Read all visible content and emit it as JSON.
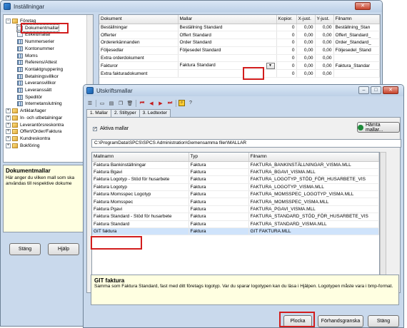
{
  "back_window": {
    "title": "Inställningar",
    "tree": [
      {
        "label": "Företag",
        "exp": "−",
        "icon": "folder",
        "indent": 0
      },
      {
        "label": "Dokumentmallar",
        "icon": "doc",
        "indent": 1,
        "selected": true
      },
      {
        "label": "Etikettmallar",
        "icon": "doc",
        "indent": 1
      },
      {
        "label": "Nummerserier",
        "icon": "grid",
        "indent": 1
      },
      {
        "label": "Kontonummer",
        "icon": "grid",
        "indent": 1
      },
      {
        "label": "Moms",
        "icon": "grid",
        "indent": 1
      },
      {
        "label": "Referens/Attest",
        "icon": "grid",
        "indent": 1
      },
      {
        "label": "Kontaktgruppering",
        "icon": "grid",
        "indent": 1
      },
      {
        "label": "Betalningsvillkor",
        "icon": "grid",
        "indent": 1
      },
      {
        "label": "Leveransvillkor",
        "icon": "grid",
        "indent": 1
      },
      {
        "label": "Leveranssätt",
        "icon": "grid",
        "indent": 1
      },
      {
        "label": "Speditör",
        "icon": "grid",
        "indent": 1
      },
      {
        "label": "Internetanslutning",
        "icon": "grid",
        "indent": 1
      },
      {
        "label": "Artiklar/lager",
        "exp": "+",
        "icon": "folder",
        "indent": 0
      },
      {
        "label": "In- och utbetalningar",
        "exp": "+",
        "icon": "folder",
        "indent": 0
      },
      {
        "label": "Leverantörsreskontra",
        "exp": "+",
        "icon": "folder",
        "indent": 0
      },
      {
        "label": "Offert/Order/Faktura",
        "exp": "+",
        "icon": "folder",
        "indent": 0
      },
      {
        "label": "Kundreskontra",
        "exp": "+",
        "icon": "folder",
        "indent": 0
      },
      {
        "label": "Bokföring",
        "exp": "+",
        "icon": "folder",
        "indent": 0
      }
    ],
    "desc": {
      "heading": "Dokumentmallar",
      "text1": "Här anger du vilken mall som ska",
      "text2": "användas till respektive dokume"
    },
    "buttons": {
      "close": "Stäng",
      "help": "Hjälp"
    },
    "grid": {
      "columns": [
        "Dokument",
        "Mallar",
        "Kopior.",
        "X-just.",
        "Y-just.",
        "Filnamn"
      ],
      "rows": [
        [
          "Beställningar",
          "Beställning Standard",
          "0",
          "0,00",
          "0,00",
          "Beställning_Stan"
        ],
        [
          "Offerter",
          "Offert Standard",
          "0",
          "0,00",
          "0,00",
          "Offert_Standard_"
        ],
        [
          "Ordererkännanden",
          "Order Standard",
          "0",
          "0,00",
          "0,00",
          "Order_Standard_"
        ],
        [
          "Följesedlar",
          "Följesedel Standard",
          "0",
          "0,00",
          "0,00",
          "Följesedel_Stand"
        ],
        [
          "Extra orderdokument",
          "",
          "0",
          "0,00",
          "0,00",
          ""
        ],
        [
          "Fakturor",
          "Faktura Standard",
          "0",
          "0,00",
          "0,00",
          "Faktura_Standar"
        ],
        [
          "Extra fakturadokument",
          "",
          "0",
          "0,00",
          "0,00",
          ""
        ]
      ]
    }
  },
  "front_window": {
    "title": "Utskriftsmallar",
    "tabs": [
      "1. Mallar",
      "2. Stiltyper",
      "3. Ledtexter"
    ],
    "active_mallar_label": "Aktiva mallar",
    "fetch_button": "Hämta mallar...",
    "path": "C:\\ProgramData\\SPCS\\SPCS Administration\\Gemensamma filer\\MALLAR",
    "columns": [
      "Mallnamn",
      "Typ",
      "Filnamn"
    ],
    "rows": [
      [
        "Faktura Bankinställningar",
        "Faktura",
        "FAKTURA_BANKINSTÄLLNINGAR_VISMA.MLL"
      ],
      [
        "Faktura Bgavi",
        "Faktura",
        "FAKTURA_BGAVI_VISMA.MLL"
      ],
      [
        "Faktura Logotyp - Stöd för husarbete",
        "Faktura",
        "FAKTURA_LOGOTYP_STÖD_FÖR_HUSARBETE_VIS"
      ],
      [
        "Faktura Logotyp",
        "Faktura",
        "FAKTURA_LOGOTYP_VISMA.MLL"
      ],
      [
        "Faktura Momsspec Logotyp",
        "Faktura",
        "FAKTURA_MOMSSPEC_LOGOTYP_VISMA.MLL"
      ],
      [
        "Faktura Momsspec",
        "Faktura",
        "FAKTURA_MOMSSPEC_VISMA.MLL"
      ],
      [
        "Faktura Pgavi",
        "Faktura",
        "FAKTURA_PGAVI_VISMA.MLL"
      ],
      [
        "Faktura Standard - Stöd för husarbete",
        "Faktura",
        "FAKTURA_STANDARD_STÖD_FÖR_HUSARBETE_VIS"
      ],
      [
        "Faktura Standard",
        "Faktura",
        "FAKTURA_STANDARD_VISMA.MLL"
      ],
      [
        "GIT faktura",
        "Faktura",
        "GIT FAKTURA.MLL"
      ]
    ],
    "desc": {
      "heading": "GIT faktura",
      "text": "Samma som Faktura Standard, fast med ditt företags logotyp. Var du sparar logotypen kan du läsa i Hjälpen. Logotypen måste vara i bmp-format."
    },
    "buttons": {
      "pick": "Plocka",
      "preview": "Förhandsgranska",
      "close": "Stäng"
    }
  }
}
